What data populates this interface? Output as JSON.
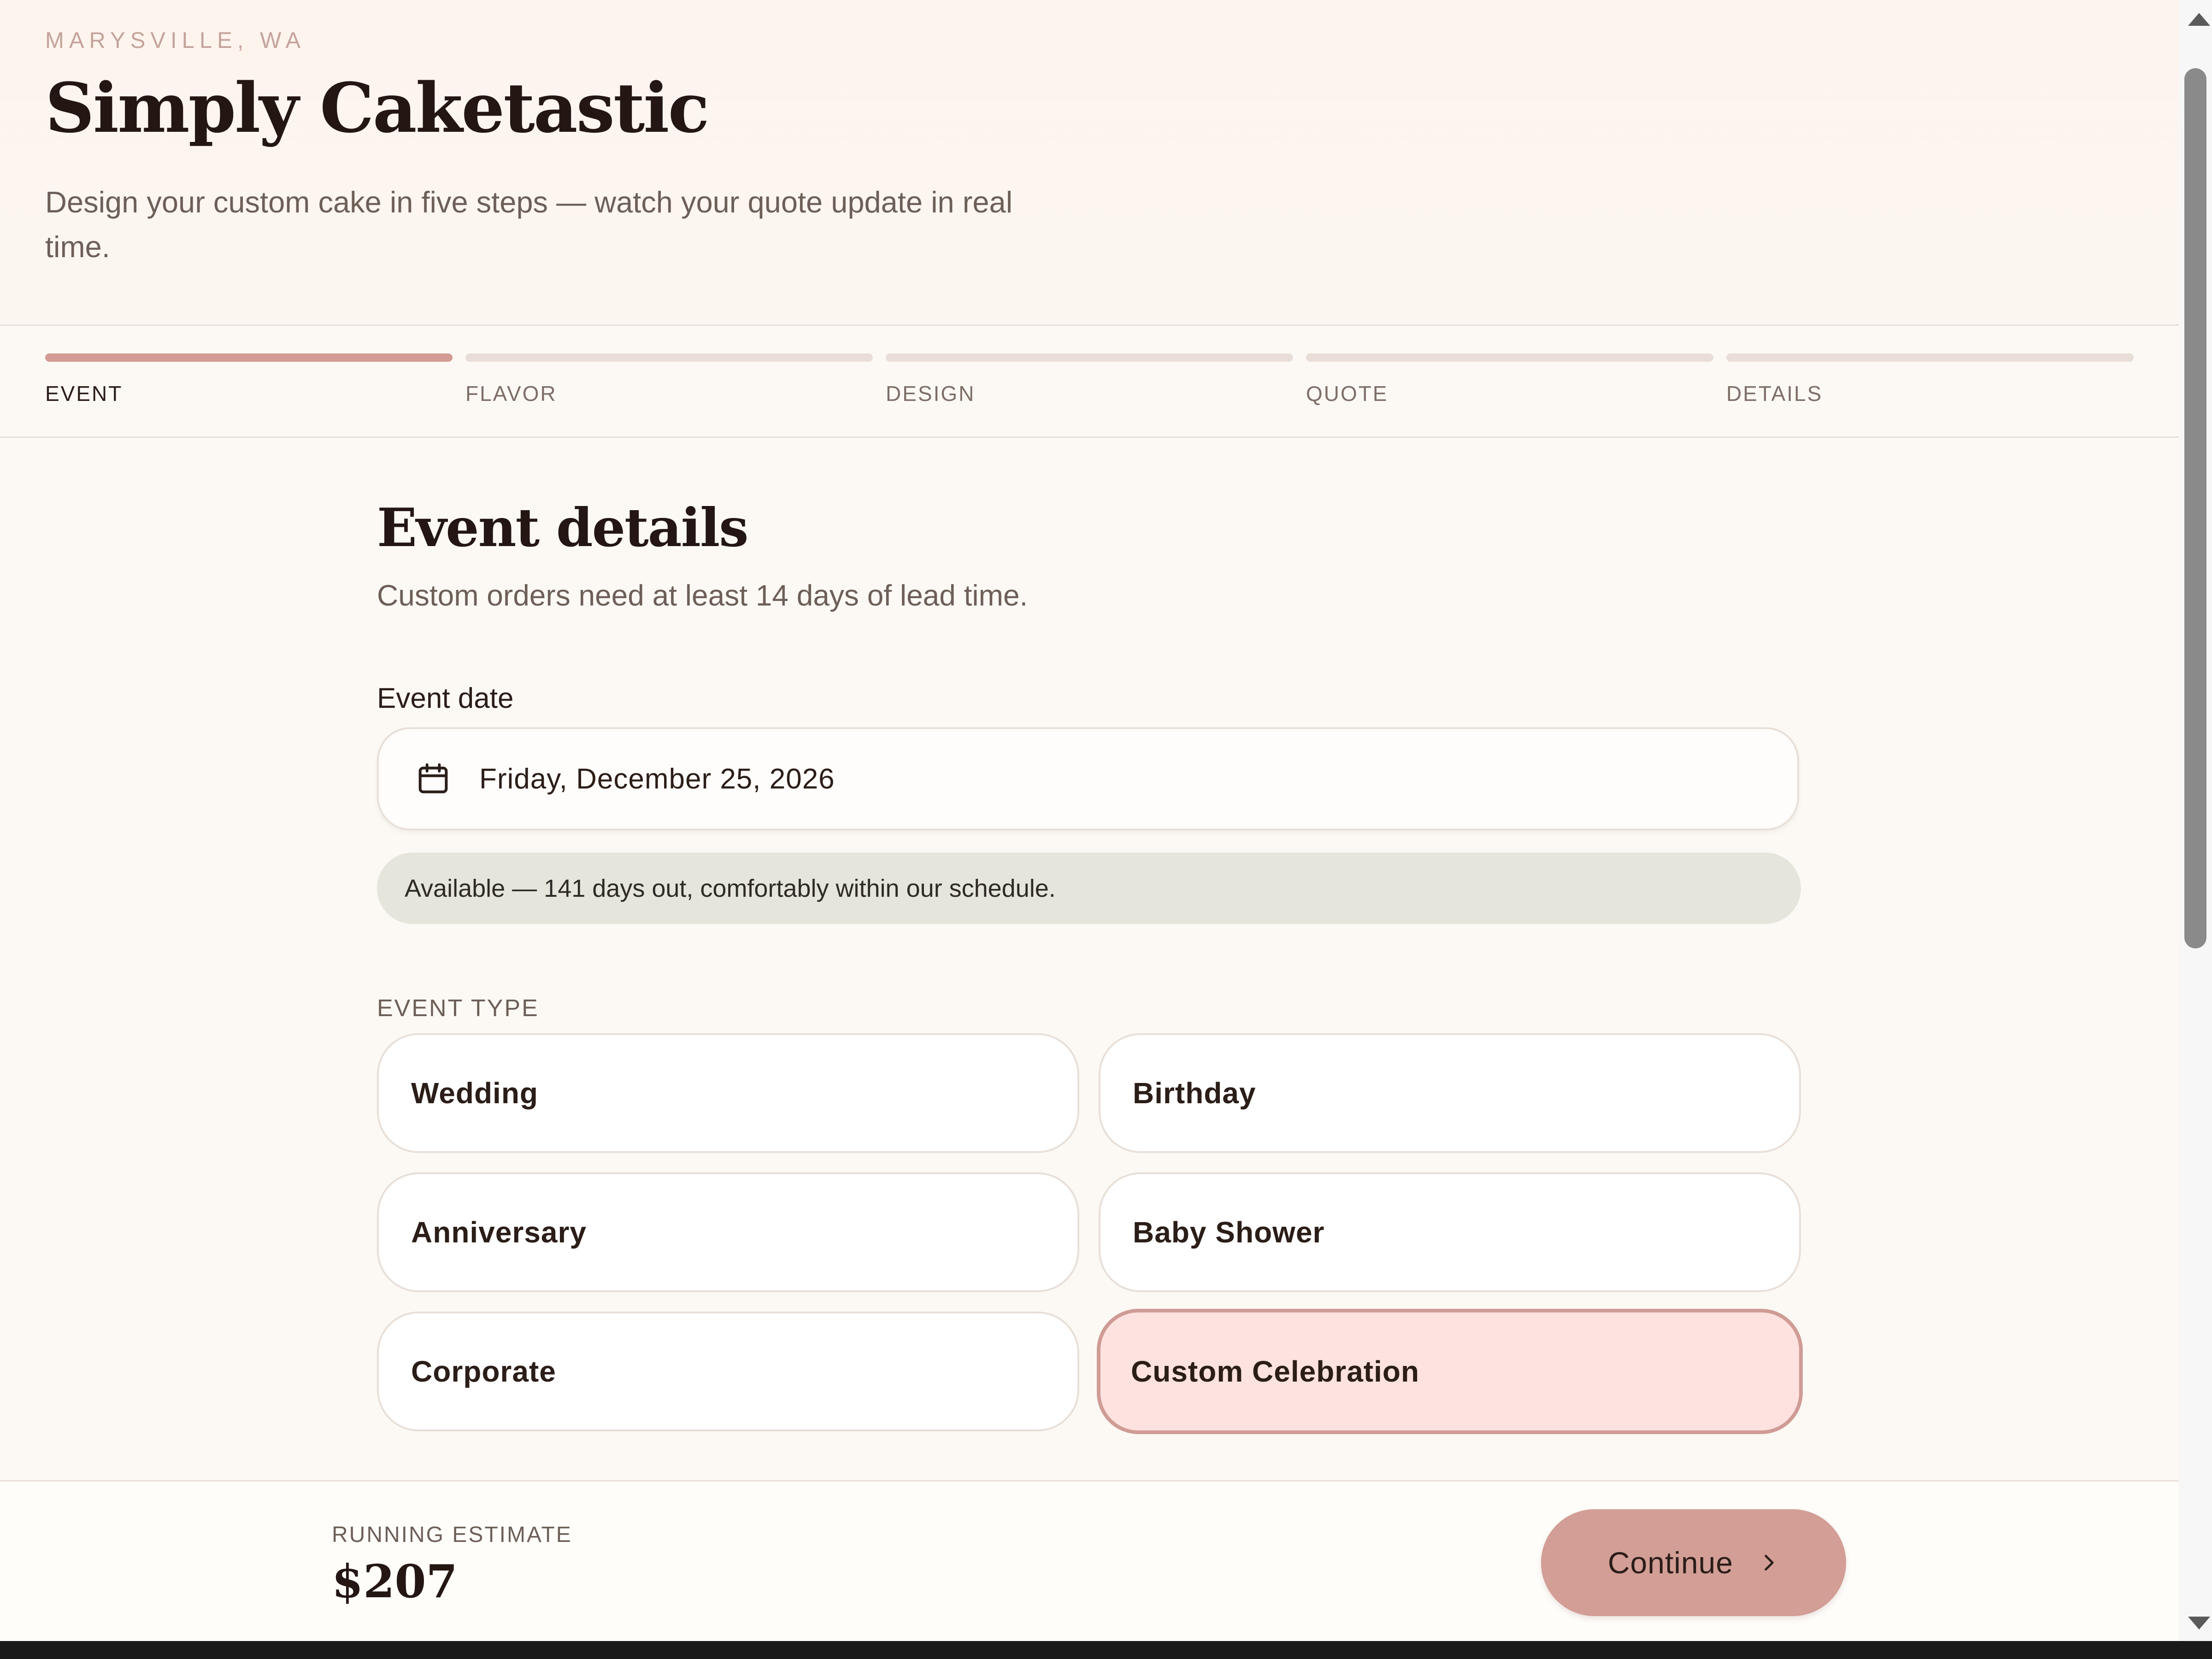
{
  "header": {
    "location": "MARYSVILLE, WA",
    "brand": "Simply Caketastic",
    "tagline": "Design your custom cake in five steps — watch your quote update in real time."
  },
  "stepper": {
    "active_index": 0,
    "steps": [
      {
        "label": "EVENT"
      },
      {
        "label": "FLAVOR"
      },
      {
        "label": "DESIGN"
      },
      {
        "label": "QUOTE"
      },
      {
        "label": "DETAILS"
      }
    ]
  },
  "main": {
    "title": "Event details",
    "subtitle": "Custom orders need at least 14 days of lead time.",
    "event_date": {
      "label": "Event date",
      "value": "Friday, December 25, 2026",
      "icon": "calendar-icon"
    },
    "availability": "Available — 141 days out, comfortably within our schedule.",
    "event_type": {
      "label": "EVENT TYPE",
      "selected": "Custom Celebration",
      "options": [
        "Wedding",
        "Birthday",
        "Anniversary",
        "Baby Shower",
        "Corporate",
        "Custom Celebration"
      ]
    }
  },
  "footer": {
    "estimate_label": "RUNNING ESTIMATE",
    "estimate_value": "$207",
    "continue_label": "Continue",
    "continue_icon": "chevron-right-icon"
  },
  "colors": {
    "accent": "#d29b93",
    "selected_bg": "#fde2df",
    "availability_bg": "#e5e5dc",
    "page_bg": "#fcf9f4"
  }
}
